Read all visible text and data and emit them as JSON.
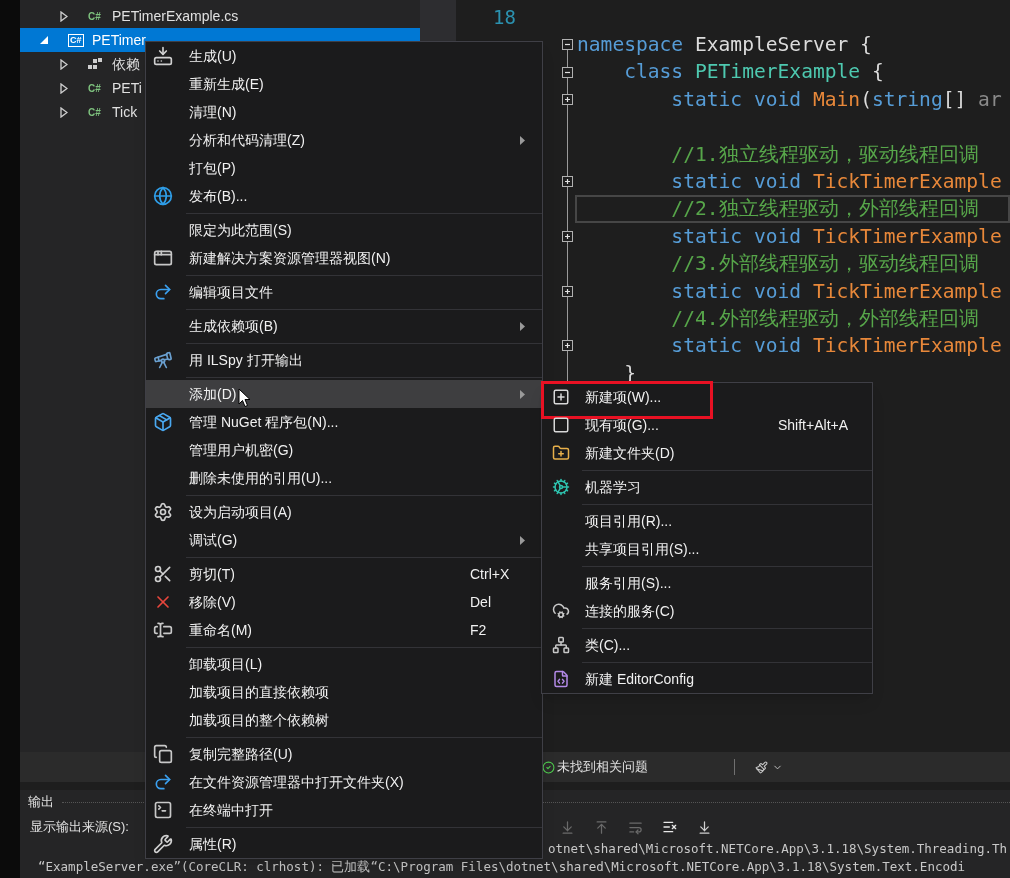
{
  "explorer": {
    "items": [
      {
        "kind": "file",
        "badge": "C#",
        "label": "PETimerExample.cs",
        "expanded": false,
        "selected": false
      },
      {
        "kind": "project",
        "badge": "C#",
        "label": "PETimer",
        "expanded": true,
        "selected": true,
        "children": [
          {
            "kind": "dependencies",
            "label": "依赖",
            "expanded": false,
            "selected": false
          },
          {
            "kind": "file",
            "badge": "C#",
            "label": "PETi",
            "expanded": false,
            "selected": false
          },
          {
            "kind": "file",
            "badge": "C#",
            "label": "Tick",
            "expanded": false,
            "selected": false
          }
        ]
      }
    ]
  },
  "editor": {
    "line_number": "18",
    "lines": [
      {
        "collapsed": false,
        "current": false,
        "tokens": [
          {
            "kind": "keyword",
            "text": "namespace"
          },
          {
            "kind": "plain",
            "text": " ExampleServer {"
          }
        ]
      },
      {
        "collapsed": false,
        "current": false,
        "tokens": [
          {
            "kind": "keyword",
            "text": "    class"
          },
          {
            "kind": "type",
            "text": " PETimerExample"
          },
          {
            "kind": "plain",
            "text": " {"
          }
        ]
      },
      {
        "collapsed": true,
        "current": false,
        "tokens": [
          {
            "kind": "keyword",
            "text": "        static void"
          },
          {
            "kind": "method",
            "text": " Main"
          },
          {
            "kind": "plain",
            "text": "("
          },
          {
            "kind": "keyword",
            "text": "string"
          },
          {
            "kind": "plain",
            "text": "[] "
          },
          {
            "kind": "param",
            "text": "ar"
          }
        ]
      },
      {
        "current": false
      },
      {
        "current": false,
        "tokens": [
          {
            "kind": "comment",
            "text": "        //1.独立线程驱动，驱动线程回调"
          }
        ]
      },
      {
        "collapsed": true,
        "current": false,
        "tokens": [
          {
            "kind": "keyword",
            "text": "        static void"
          },
          {
            "kind": "method",
            "text": " TickTimerExample"
          }
        ]
      },
      {
        "current": true,
        "tokens": [
          {
            "kind": "comment",
            "text": "        //2.独立线程驱动，外部线程回调"
          }
        ]
      },
      {
        "collapsed": true,
        "current": false,
        "tokens": [
          {
            "kind": "keyword",
            "text": "        static void"
          },
          {
            "kind": "method",
            "text": " TickTimerExample"
          }
        ]
      },
      {
        "current": false,
        "tokens": [
          {
            "kind": "comment",
            "text": "        //3.外部线程驱动，驱动线程回调"
          }
        ]
      },
      {
        "collapsed": true,
        "current": false,
        "tokens": [
          {
            "kind": "keyword",
            "text": "        static void"
          },
          {
            "kind": "method",
            "text": " TickTimerExample"
          }
        ]
      },
      {
        "current": false,
        "tokens": [
          {
            "kind": "comment",
            "text": "        //4.外部线程驱动，外部线程回调"
          }
        ]
      },
      {
        "collapsed": true,
        "current": false,
        "tokens": [
          {
            "kind": "keyword",
            "text": "        static void"
          },
          {
            "kind": "method",
            "text": " TickTimerExample"
          }
        ]
      },
      {
        "current": false,
        "tokens": [
          {
            "kind": "plain",
            "text": "    }"
          }
        ]
      }
    ]
  },
  "context_menu": {
    "groups": [
      [
        {
          "label": "生成(U)",
          "submenu": false,
          "selected": false
        },
        {
          "label": "重新生成(E)",
          "submenu": false,
          "selected": false
        },
        {
          "label": "清理(N)",
          "submenu": false,
          "selected": false
        },
        {
          "label": "分析和代码清理(Z)",
          "submenu": true,
          "selected": false
        },
        {
          "label": "打包(P)",
          "submenu": false,
          "selected": false
        },
        {
          "label": "发布(B)...",
          "submenu": false,
          "selected": false
        }
      ],
      [
        {
          "label": "限定为此范围(S)",
          "submenu": false,
          "selected": false
        },
        {
          "label": "新建解决方案资源管理器视图(N)",
          "submenu": false,
          "selected": false
        }
      ],
      [
        {
          "label": "编辑项目文件",
          "submenu": false,
          "selected": false
        }
      ],
      [
        {
          "label": "生成依赖项(B)",
          "submenu": true,
          "selected": false
        }
      ],
      [
        {
          "label": "用 ILSpy 打开输出",
          "submenu": false,
          "selected": false
        }
      ],
      [
        {
          "label": "添加(D)",
          "submenu": true,
          "selected": true
        },
        {
          "label": "管理 NuGet 程序包(N)...",
          "submenu": false,
          "selected": false
        },
        {
          "label": "管理用户机密(G)",
          "submenu": false,
          "selected": false
        },
        {
          "label": "删除未使用的引用(U)...",
          "submenu": false,
          "selected": false
        }
      ],
      [
        {
          "label": "设为启动项目(A)",
          "submenu": false,
          "selected": false
        },
        {
          "label": "调试(G)",
          "submenu": true,
          "selected": false
        }
      ],
      [
        {
          "label": "剪切(T)",
          "shortcut": "Ctrl+X",
          "submenu": false,
          "selected": false
        },
        {
          "label": "移除(V)",
          "shortcut": "Del",
          "submenu": false,
          "selected": false
        },
        {
          "label": "重命名(M)",
          "shortcut": "F2",
          "submenu": false,
          "selected": false
        }
      ],
      [
        {
          "label": "卸载项目(L)",
          "submenu": false,
          "selected": false
        },
        {
          "label": "加载项目的直接依赖项",
          "submenu": false,
          "selected": false
        },
        {
          "label": "加载项目的整个依赖树",
          "submenu": false,
          "selected": false
        }
      ],
      [
        {
          "label": "复制完整路径(U)",
          "submenu": false,
          "selected": false
        },
        {
          "label": "在文件资源管理器中打开文件夹(X)",
          "submenu": false,
          "selected": false
        },
        {
          "label": "在终端中打开",
          "submenu": false,
          "selected": false
        }
      ],
      [
        {
          "label": "属性(R)",
          "submenu": false,
          "selected": false
        }
      ]
    ]
  },
  "submenu": {
    "groups": [
      [
        {
          "label": "新建项(W)...",
          "framed": true
        },
        {
          "label": "现有项(G)...",
          "shortcut": "Shift+Alt+A",
          "framed": false
        },
        {
          "label": "新建文件夹(D)",
          "framed": false
        }
      ],
      [
        {
          "label": "机器学习",
          "framed": false
        }
      ],
      [
        {
          "label": "项目引用(R)...",
          "framed": false
        },
        {
          "label": "共享项目引用(S)...",
          "framed": false
        }
      ],
      [
        {
          "label": "服务引用(S)...",
          "framed": false
        },
        {
          "label": "连接的服务(C)",
          "framed": false
        }
      ],
      [
        {
          "label": "类(C)...",
          "framed": false
        }
      ],
      [
        {
          "label": "新建 EditorConfig",
          "framed": false
        }
      ]
    ]
  },
  "status_bar": {
    "issues": "未找到相关问题"
  },
  "output": {
    "title": "输出",
    "source_label": "显示输出来源(S):",
    "lines": [
      "otnet\\shared\\Microsoft.NETCore.App\\3.1.18\\System.Threading.Th",
      "“ExampleServer.exe”(CoreCLR: clrhost): 已加载“C:\\Program Files\\dotnet\\shared\\Microsoft.NETCore.App\\3.1.18\\System.Text.Encodi"
    ]
  }
}
